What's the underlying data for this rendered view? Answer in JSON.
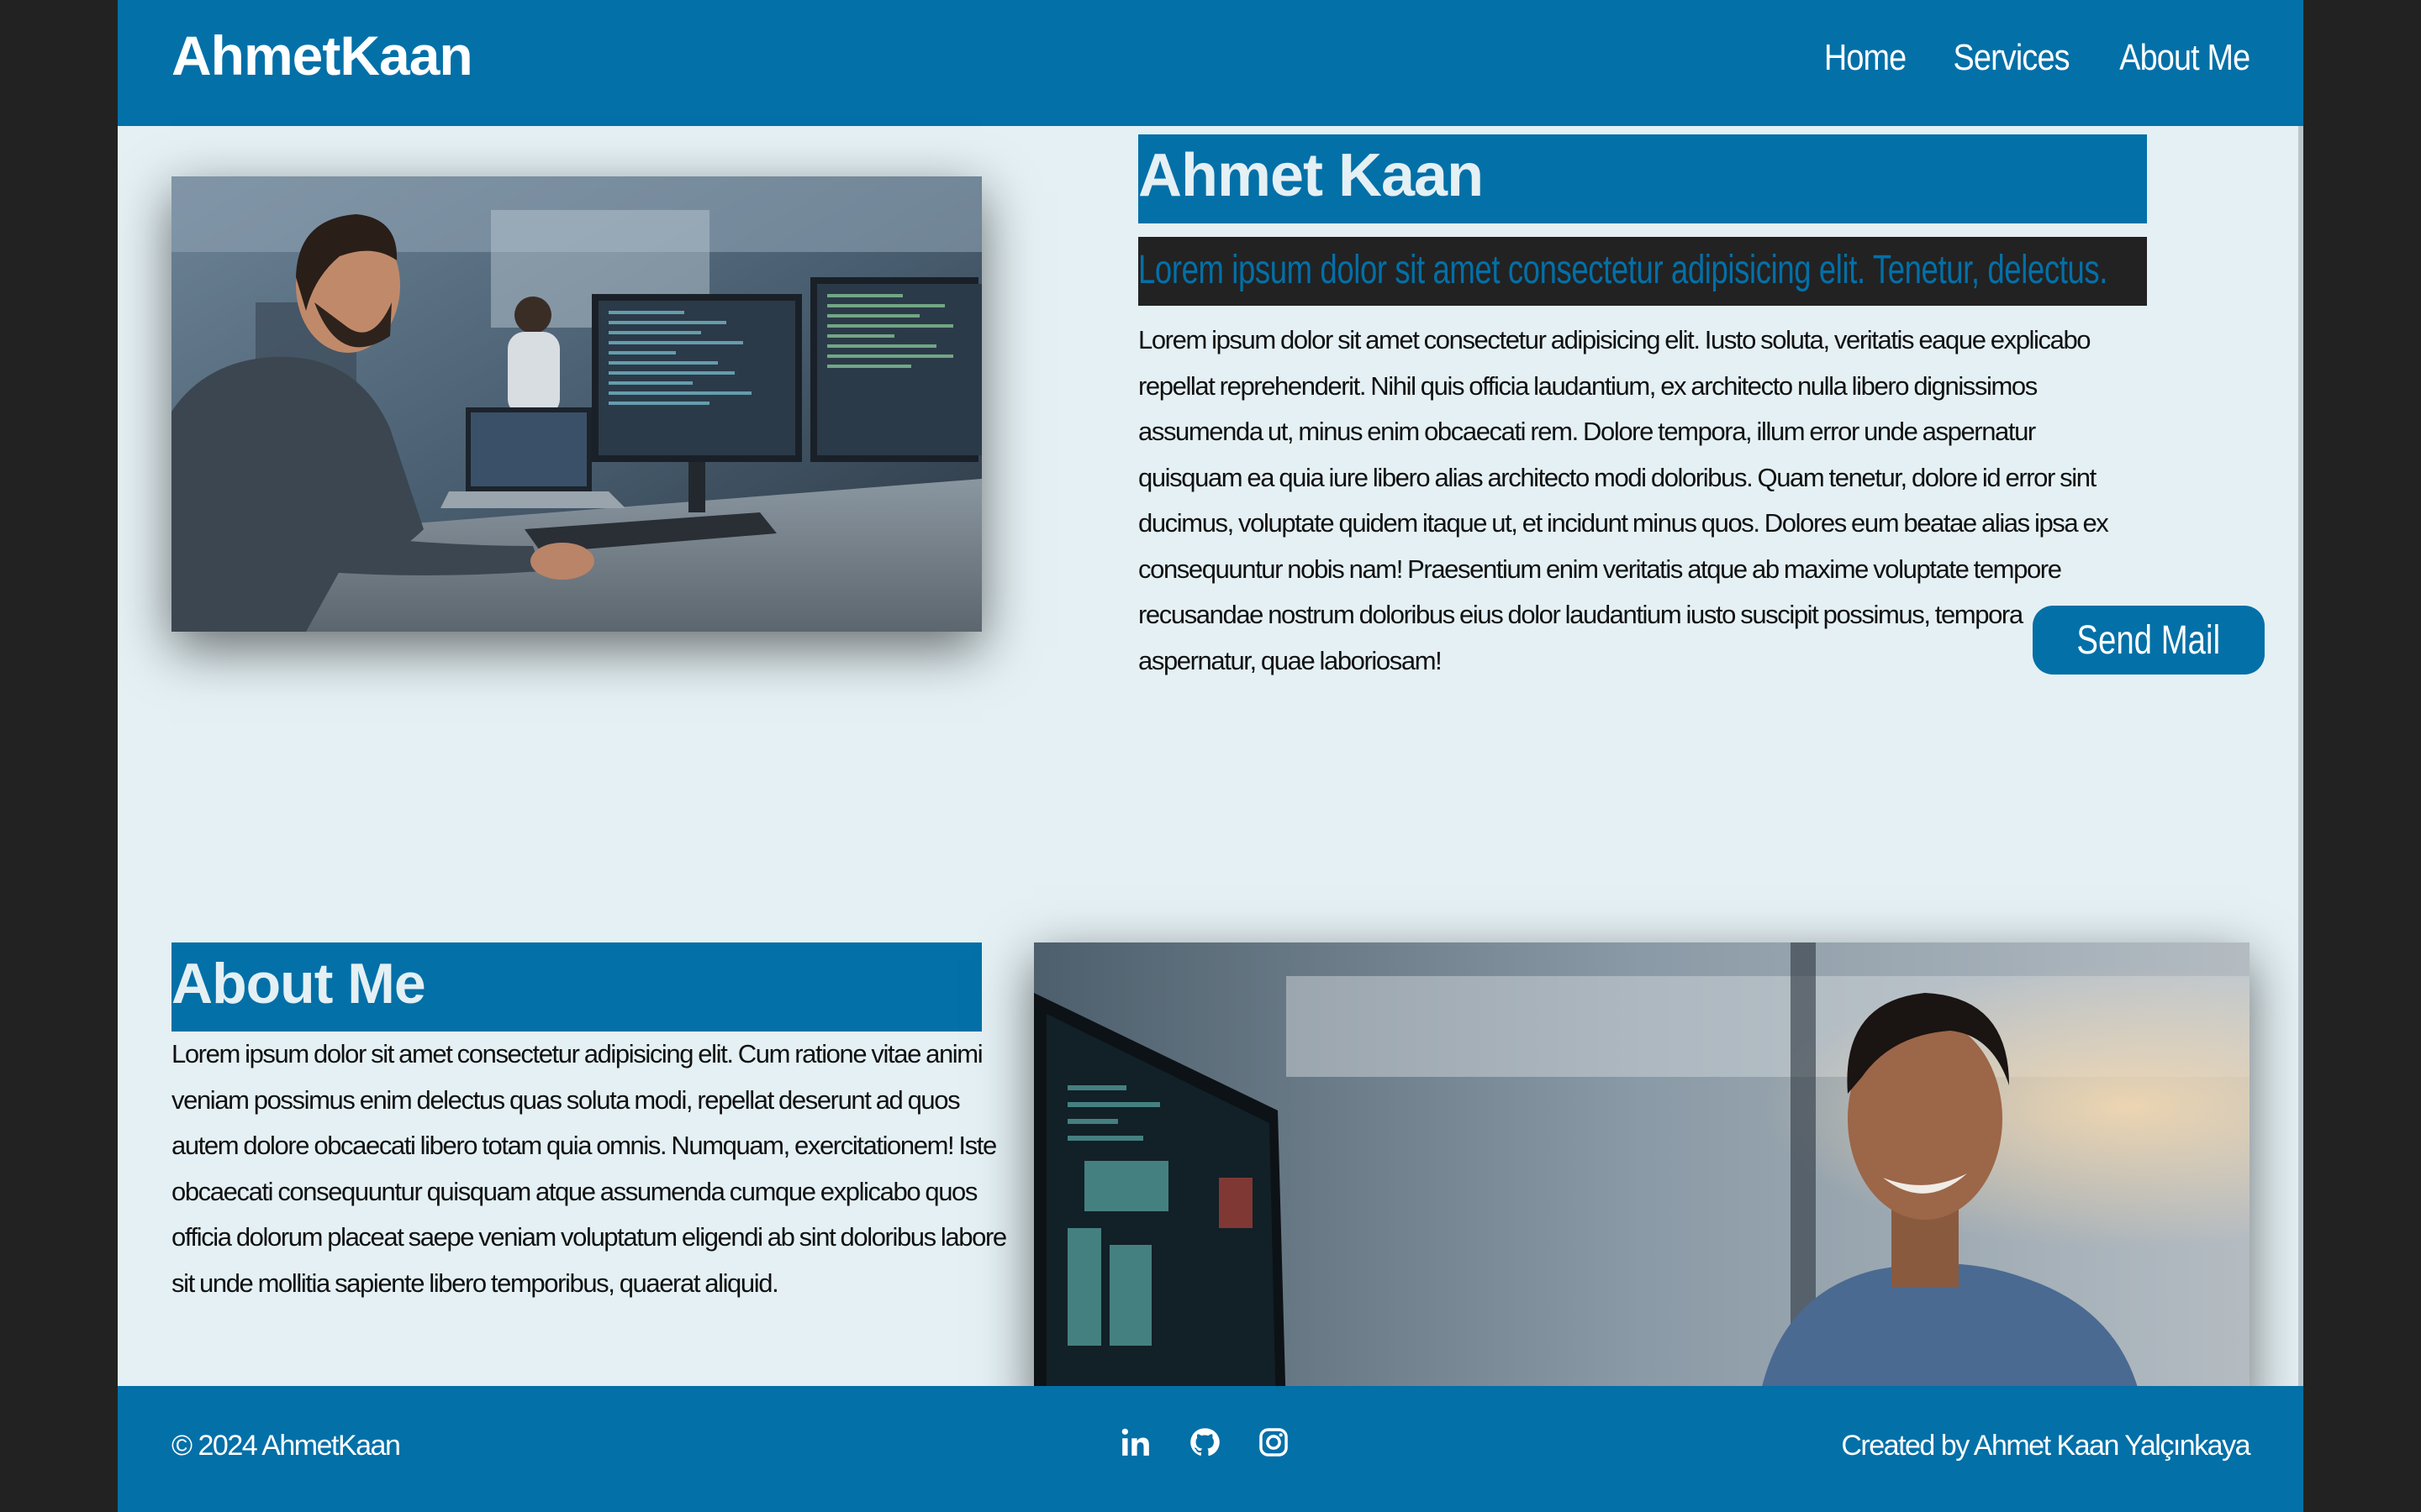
{
  "brand": "AhmetKaan",
  "nav": {
    "home": "Home",
    "services": "Services",
    "about": "About Me"
  },
  "hero": {
    "name": "Ahmet Kaan",
    "subtitle": "Lorem ipsum dolor sit amet consectetur adipisicing elit. Tenetur, delectus.",
    "body": "Lorem ipsum dolor sit amet consectetur adipisicing elit. Iusto soluta, veritatis eaque explicabo repellat reprehenderit. Nihil quis officia laudantium, ex architecto nulla libero dignissimos assumenda ut, minus enim obcaecati rem. Dolore tempora, illum error unde aspernatur quisquam ea quia iure libero alias architecto modi doloribus. Quam tenetur, dolore id error sint ducimus, voluptate quidem itaque ut, et incidunt minus quos. Dolores eum beatae alias ipsa ex consequuntur nobis nam! Praesentium enim veritatis atque ab maxime voluptate tempore recusandae nostrum doloribus eius dolor laudantium iusto suscipit possimus, tempora aspernatur, quae laboriosam!",
    "button": "Send Mail"
  },
  "about": {
    "title": "About Me",
    "body": "Lorem ipsum dolor sit amet consectetur adipisicing elit. Cum ratione vitae animi veniam possimus enim delectus quas soluta modi, repellat deserunt ad quos autem dolore obcaecati libero totam quia omnis. Numquam, exercitationem! Iste obcaecati consequuntur quisquam atque assumenda cumque explicabo quos officia dolorum placeat saepe veniam voluptatum eligendi ab sint doloribus labore sit unde mollitia sapiente libero temporibus, quaerat aliquid."
  },
  "footer": {
    "copyright": "© 2024 AhmetKaan",
    "credit": "Created by Ahmet Kaan Yalçınkaya",
    "social_icons": [
      "linkedin-icon",
      "github-icon",
      "instagram-icon"
    ]
  },
  "colors": {
    "primary": "#0370a8",
    "background": "#e4f0f4",
    "dark": "#222222"
  }
}
